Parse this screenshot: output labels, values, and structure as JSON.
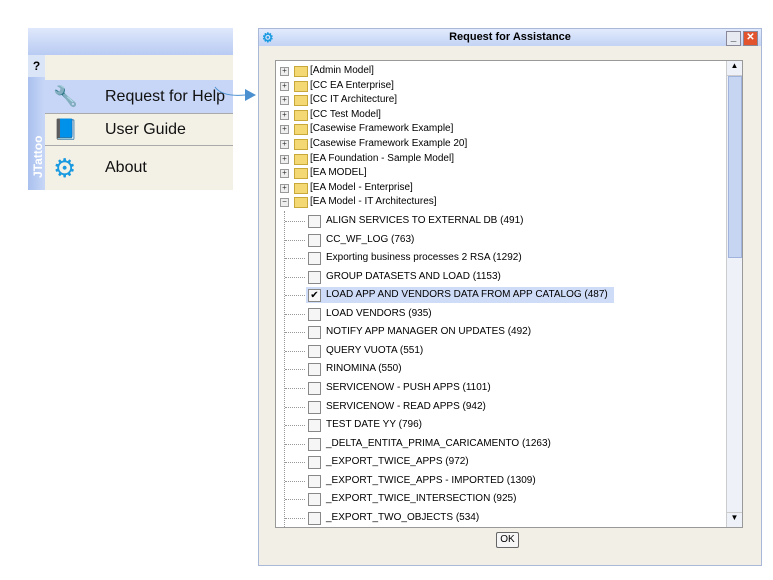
{
  "left_panel": {
    "help_tab": "?",
    "brand": "JTattoo",
    "menu": [
      {
        "label": "Request for Help",
        "icon": "wrench-icon"
      },
      {
        "label": "User Guide",
        "icon": "guide-icon"
      },
      {
        "label": "About",
        "icon": "er-gear-icon"
      }
    ]
  },
  "dialog": {
    "title": "Request for Assistance",
    "ok": "OK",
    "folders": [
      "[Admin Model]",
      "[CC EA Enterprise]",
      "[CC IT Architecture]",
      "[CC Test Model]",
      "[Casewise Framework Example]",
      "[Casewise Framework Example 20]",
      "[EA Foundation - Sample Model]",
      "[EA MODEL]",
      "[EA Model - Enterprise]",
      "[EA Model - IT Architectures]"
    ],
    "items": [
      {
        "label": "ALIGN SERVICES TO EXTERNAL DB (491)",
        "checked": false
      },
      {
        "label": "CC_WF_LOG (763)",
        "checked": false
      },
      {
        "label": "Exporting business processes 2 RSA (1292)",
        "checked": false
      },
      {
        "label": "GROUP DATASETS AND LOAD (1153)",
        "checked": false
      },
      {
        "label": "LOAD APP AND VENDORS DATA FROM APP CATALOG (487)",
        "checked": true
      },
      {
        "label": "LOAD VENDORS (935)",
        "checked": false
      },
      {
        "label": "NOTIFY APP MANAGER ON UPDATES (492)",
        "checked": false
      },
      {
        "label": "QUERY VUOTA (551)",
        "checked": false
      },
      {
        "label": "RINOMINA (550)",
        "checked": false
      },
      {
        "label": "SERVICENOW - PUSH APPS (1101)",
        "checked": false
      },
      {
        "label": "SERVICENOW - READ APPS (942)",
        "checked": false
      },
      {
        "label": "TEST DATE YY (796)",
        "checked": false
      },
      {
        "label": "_DELTA_ENTITA_PRIMA_CARICAMENTO (1263)",
        "checked": false
      },
      {
        "label": "_EXPORT_TWICE_APPS (972)",
        "checked": false
      },
      {
        "label": "_EXPORT_TWICE_APPS - IMPORTED (1309)",
        "checked": false
      },
      {
        "label": "_EXPORT_TWICE_INTERSECTION (925)",
        "checked": false
      },
      {
        "label": "_EXPORT_TWO_OBJECTS (534)",
        "checked": false
      }
    ]
  }
}
